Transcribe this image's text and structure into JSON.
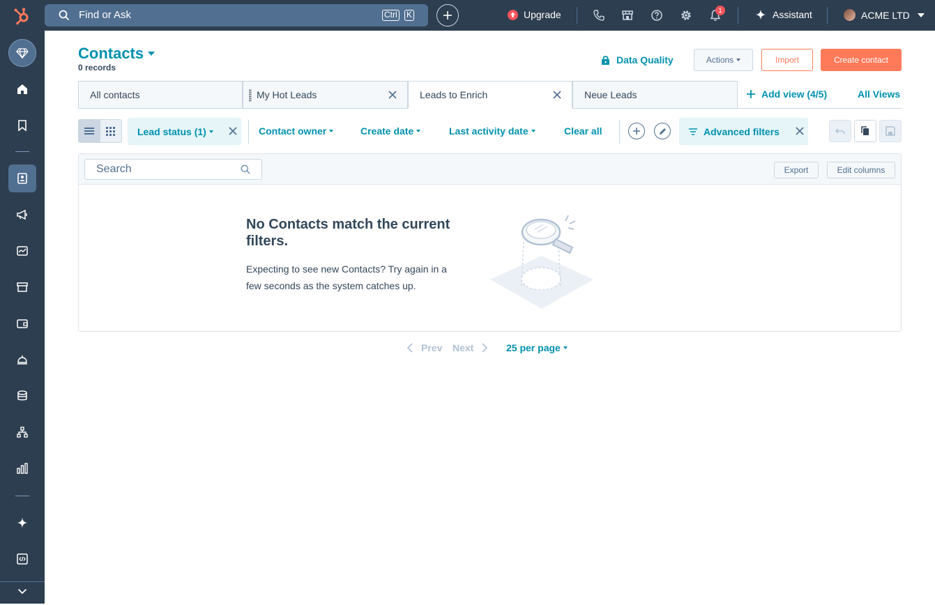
{
  "topbar": {
    "search_label": "Find or Ask",
    "shortcut_ctrl": "Ctrl",
    "shortcut_key": "K",
    "upgrade_label": "Upgrade",
    "notification_count": "1",
    "assistant_label": "Assistant",
    "account_name": "ACME LTD"
  },
  "sidebar": {
    "icons": [
      "workspace-icon",
      "home-icon",
      "bookmark-icon",
      "contacts-icon",
      "marketing-icon",
      "sales-icon",
      "commerce-icon",
      "payments-icon",
      "service-icon",
      "data-icon",
      "automation-icon",
      "reporting-icon",
      "breeze-icon",
      "development-icon",
      "expand-icon"
    ],
    "active": "contacts-icon"
  },
  "header": {
    "title": "Contacts",
    "records": "0 records",
    "data_quality": "Data Quality",
    "actions": "Actions",
    "import": "Import",
    "create": "Create contact"
  },
  "tabs": [
    {
      "label": "All contacts",
      "closable": false
    },
    {
      "label": "My Hot Leads",
      "closable": true
    },
    {
      "label": "Leads to Enrich",
      "closable": true,
      "active": true
    },
    {
      "label": "Neue Leads",
      "closable": false
    }
  ],
  "views": {
    "add_view": "Add view (4/5)",
    "all_views": "All Views"
  },
  "filters": {
    "lead_status": "Lead status (1)",
    "contact_owner": "Contact owner",
    "create_date": "Create date",
    "last_activity": "Last activity date",
    "clear_all": "Clear all",
    "advanced": "Advanced filters"
  },
  "table": {
    "search_placeholder": "Search",
    "export": "Export",
    "edit_columns": "Edit columns",
    "empty_title": "No Contacts match the current filters.",
    "empty_text": "Expecting to see new Contacts? Try again in a few seconds as the system catches up."
  },
  "pagination": {
    "prev": "Prev",
    "next": "Next",
    "per_page": "25 per page"
  },
  "colors": {
    "nav": "#2d3e50",
    "accent": "#0091ae",
    "primary": "#ff7a59",
    "alert": "#f2545b"
  }
}
